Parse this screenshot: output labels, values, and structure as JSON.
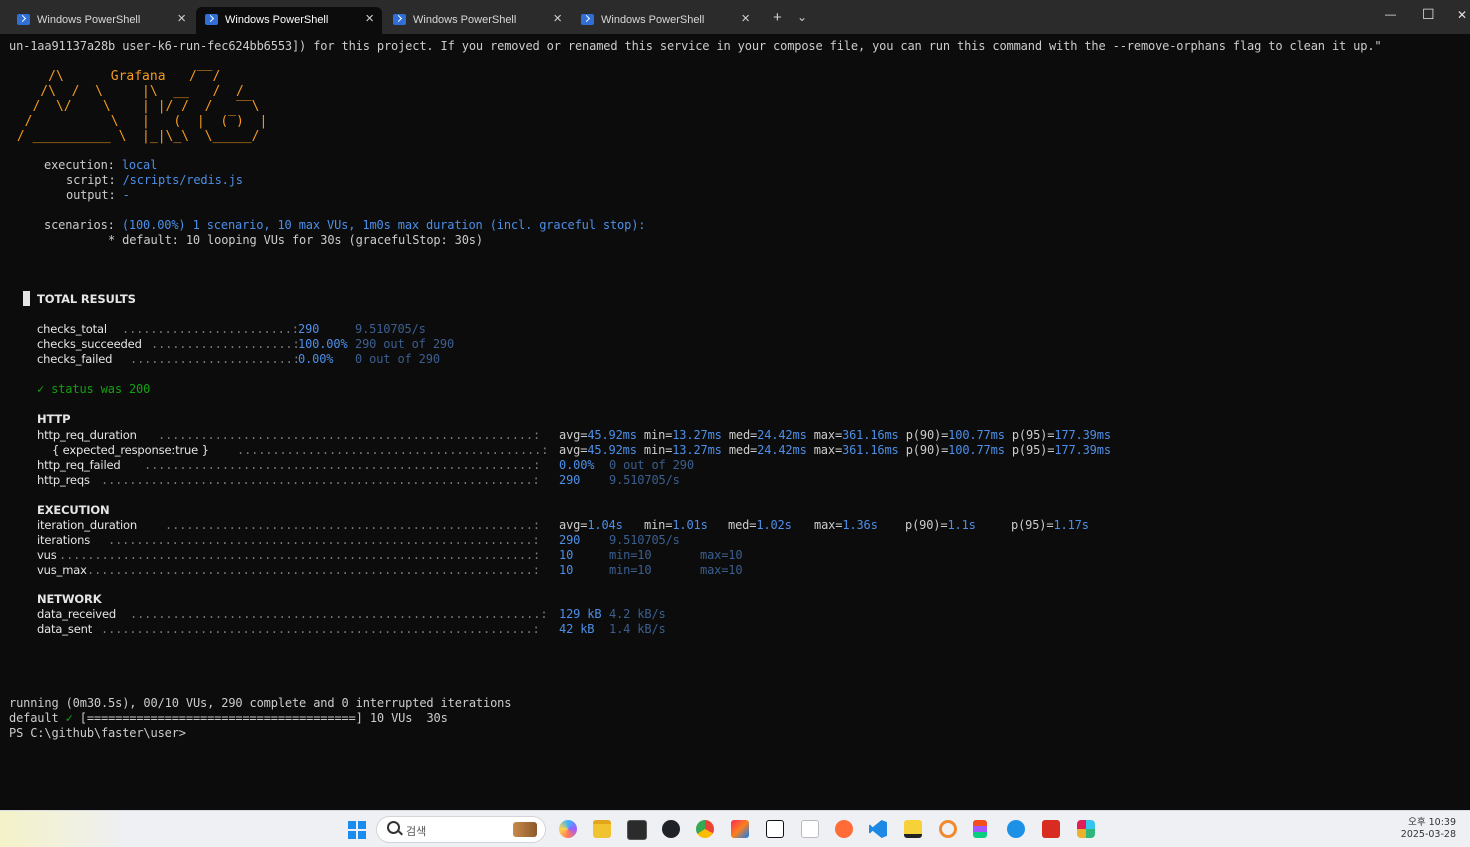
{
  "window": {
    "tabs": [
      {
        "label": "Windows PowerShell",
        "active": false
      },
      {
        "label": "Windows PowerShell",
        "active": true
      },
      {
        "label": "Windows PowerShell",
        "active": false
      },
      {
        "label": "Windows PowerShell",
        "active": false
      }
    ],
    "new_tab": "+",
    "dropdown": "⌄",
    "minimize": "—",
    "maximize": "☐",
    "close": "✕",
    "tab_close": "×"
  },
  "terminal": {
    "orphan_line": "un-1aa91137a28b user-k6-run-fec624bb6553]) for this project. If you removed or renamed this service in your compose file, you can run this command with the --remove-orphans flag to clean it up.\"",
    "logo": {
      "line1": "     /\\      ",
      "brand": "Grafana",
      "line1b": "   /‾‾/",
      "line2": "    /\\  /  \\     |\\  __   /  /",
      "line3": "   /  \\/    \\    | |/ /  /   ‾‾\\",
      "line4": "  /          \\   |   (  |  (‾)  |",
      "line5": " / __________ \\  |_|\\_\\  \\_____/"
    },
    "execution": {
      "label": "execution:",
      "value": "local"
    },
    "script": {
      "label": "script:",
      "value": "/scripts/redis.js"
    },
    "output": {
      "label": "output:",
      "value": "-"
    },
    "scenarios": {
      "label": "scenarios:",
      "value": "(100.00%) 1 scenario, 10 max VUs, 1m0s max duration (incl. graceful stop):"
    },
    "default_scenario": "* default: 10 looping VUs for 30s (gracefulStop: 30s)",
    "total_results": "TOTAL RESULTS",
    "checks": [
      {
        "name": "checks_total",
        "value": "290",
        "extra": "9.510705/s"
      },
      {
        "name": "checks_succeeded",
        "value": "100.00%",
        "extra": "290 out of 290"
      },
      {
        "name": "checks_failed",
        "value": "0.00%",
        "extra": "0 out of 290"
      }
    ],
    "status_check": "✓ status was 200",
    "http_header": "HTTP",
    "http": [
      {
        "name": "http_req_duration",
        "avg": "45.92ms",
        "min": "13.27ms",
        "med": "24.42ms",
        "max": "361.16ms",
        "p90": "100.77ms",
        "p95": "177.39ms"
      },
      {
        "name": "{ expected_response:true }",
        "avg": "45.92ms",
        "min": "13.27ms",
        "med": "24.42ms",
        "max": "361.16ms",
        "p90": "100.77ms",
        "p95": "177.39ms"
      }
    ],
    "http_req_failed": {
      "name": "http_req_failed",
      "value": "0.00%",
      "extra": "0 out of 290"
    },
    "http_reqs": {
      "name": "http_reqs",
      "value": "290",
      "extra": "9.510705/s"
    },
    "execution_header": "EXECUTION",
    "iteration_duration": {
      "name": "iteration_duration",
      "avg": "1.04s",
      "min": "1.01s",
      "med": "1.02s",
      "max": "1.36s",
      "p90": "1.1s",
      "p95": "1.17s"
    },
    "iterations": {
      "name": "iterations",
      "value": "290",
      "extra": "9.510705/s"
    },
    "vus": {
      "name": "vus",
      "value": "10",
      "min": "min=10",
      "max": "max=10"
    },
    "vus_max": {
      "name": "vus_max",
      "value": "10",
      "min": "min=10",
      "max": "max=10"
    },
    "network_header": "NETWORK",
    "data_received": {
      "name": "data_received",
      "value": "129 kB",
      "extra": "4.2 kB/s"
    },
    "data_sent": {
      "name": "data_sent",
      "value": "42 kB",
      "extra": "1.4 kB/s"
    },
    "running_line": "running (0m30.5s), 00/10 VUs, 290 complete and 0 interrupted iterations",
    "progress_label": "default",
    "progress_check": "✓",
    "progress_bar": "[======================================]",
    "progress_tail": "10 VUs  30s",
    "prompt": "PS C:\\github\\faster\\user>"
  },
  "taskbar": {
    "search_placeholder": "검색",
    "clock_time": "오후 10:39",
    "clock_date": "2025-03-28",
    "icons": [
      "windows-start-icon",
      "copilot-icon",
      "file-explorer-icon",
      "terminal-icon",
      "github-desktop-icon",
      "chrome-icon",
      "jetbrains-icon",
      "notion-icon",
      "typora-icon",
      "postman-icon",
      "vscode-icon",
      "sticky-notes-icon",
      "snipping-tool-icon",
      "figma-icon",
      "docker-icon",
      "redis-insight-icon",
      "slack-icon"
    ]
  },
  "colors": {
    "terminal_bg": "#0c0c0c",
    "blue_value": "#4d8fe6",
    "dim_value": "#3b5f8f",
    "green": "#13a10e",
    "logo_orange": "#f59b1f"
  }
}
